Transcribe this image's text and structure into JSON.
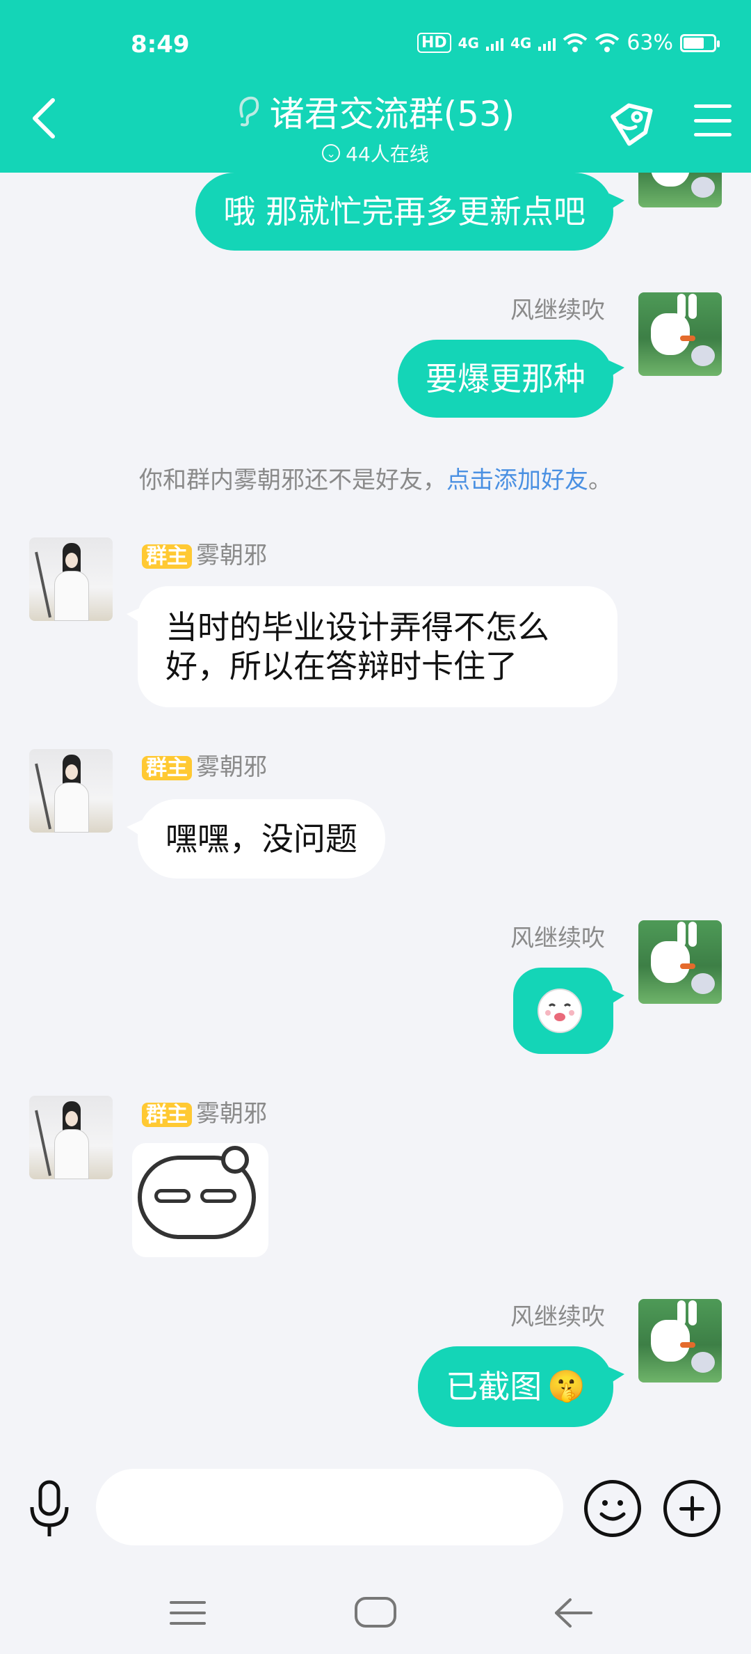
{
  "status_bar": {
    "time": "8:49",
    "hd": "HD",
    "net1": "4G",
    "net2": "4G",
    "battery": "63%"
  },
  "header": {
    "title": "诸君交流群(53)",
    "online": "44人在线"
  },
  "messages": [
    {
      "id": "m1",
      "direction": "out",
      "text": "哦 那就忙完再多更新点吧"
    },
    {
      "id": "m2",
      "direction": "out",
      "sender": "风继续吹",
      "text": "要爆更那种"
    },
    {
      "id": "m3",
      "direction": "in",
      "badge": "群主",
      "sender": "雾朝邪",
      "text_line1": "当时的毕业设计弄得不怎么",
      "text_line2": "好，所以在答辩时卡住了"
    },
    {
      "id": "m4",
      "direction": "in",
      "badge": "群主",
      "sender": "雾朝邪",
      "text": "嘿嘿，没问题"
    },
    {
      "id": "m5",
      "direction": "out",
      "sender": "风继续吹",
      "content": "emoji-sticker"
    },
    {
      "id": "m6",
      "direction": "in",
      "badge": "群主",
      "sender": "雾朝邪",
      "content": "sticker"
    },
    {
      "id": "m7",
      "direction": "out",
      "sender": "风继续吹",
      "text": "已截图",
      "emoji": "🤫"
    }
  ],
  "notice": {
    "prefix": "你和群内雾朝邪还不是好友，",
    "link": "点击添加好友",
    "suffix": "。"
  },
  "input": {
    "placeholder": ""
  },
  "colors": {
    "accent": "#14d5b7",
    "badge": "#ffc933",
    "link": "#4a90e2",
    "background": "#f3f4f8"
  }
}
